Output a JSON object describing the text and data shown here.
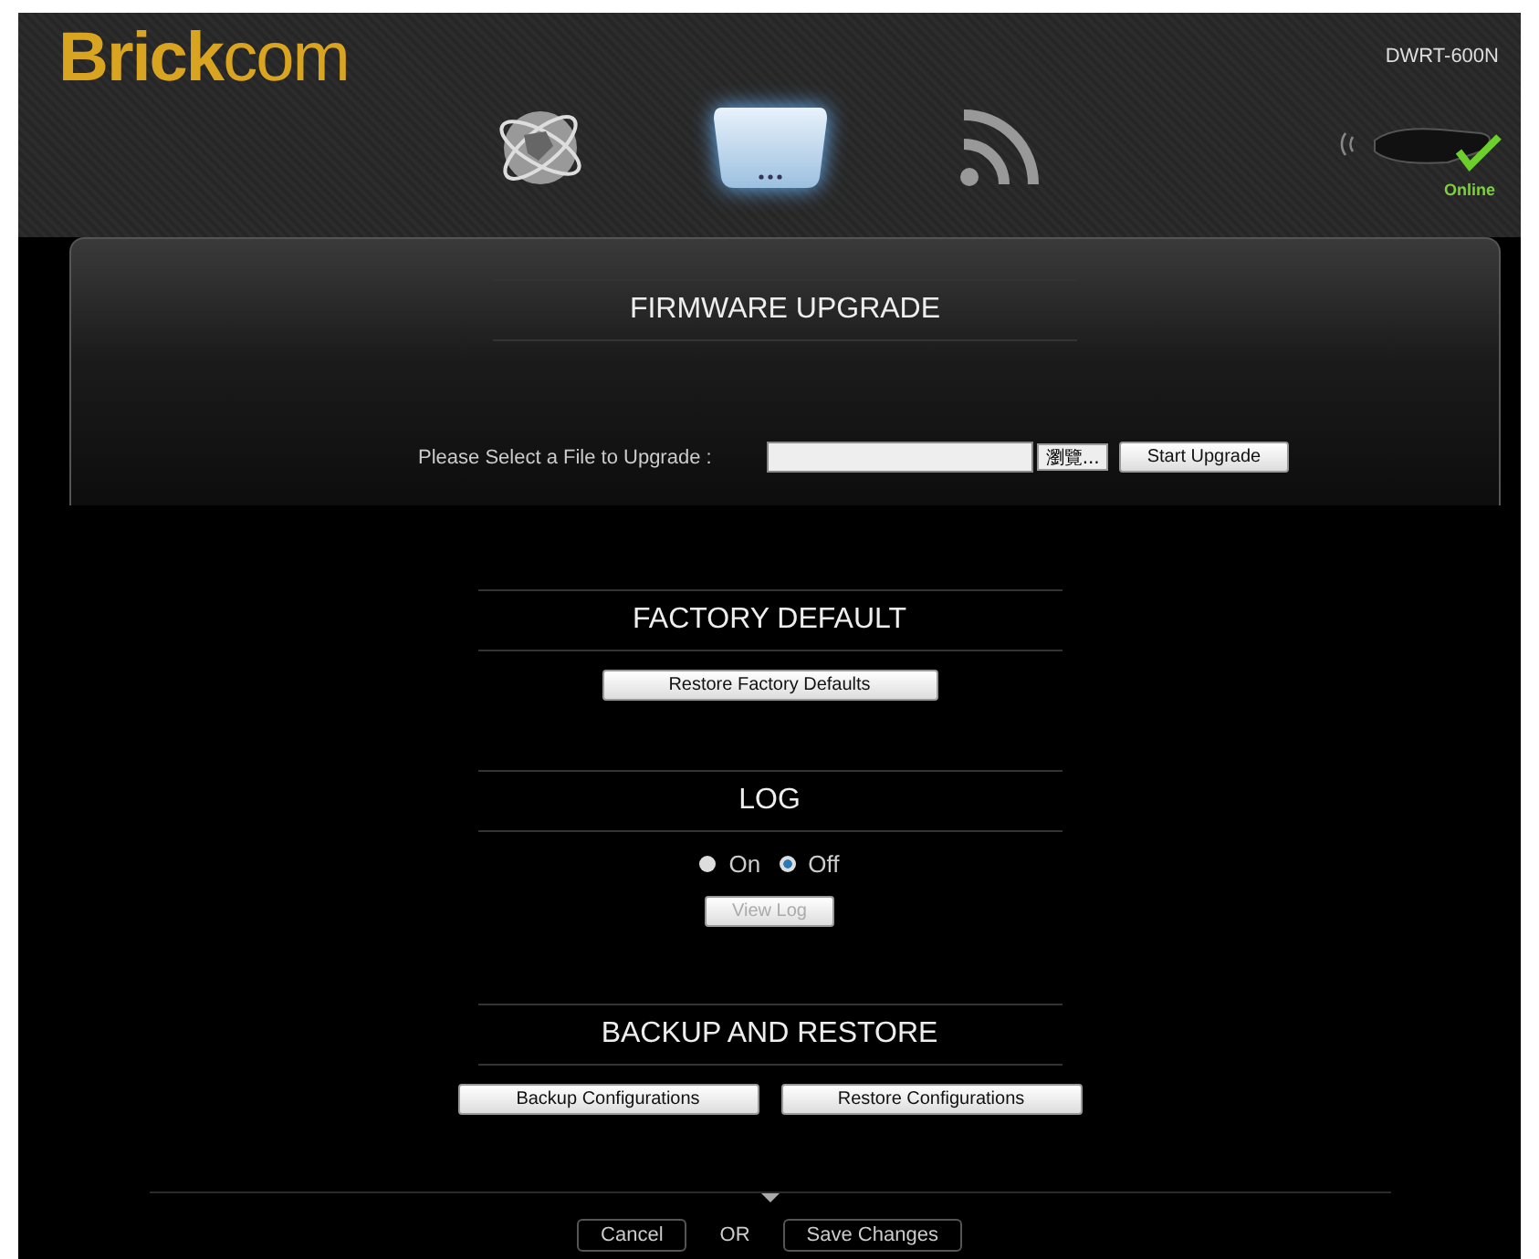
{
  "header": {
    "logo_bold": "Brick",
    "logo_light": "com",
    "model": "DWRT-600N",
    "status": "Online"
  },
  "nav": [
    {
      "kind": "globe",
      "selected": false
    },
    {
      "kind": "router",
      "selected": true
    },
    {
      "kind": "wireless",
      "selected": false
    }
  ],
  "sections": [
    {
      "kind": "upload",
      "title": "FIRMWARE UPGRADE",
      "label": "Please Select a File to Upgrade :",
      "browse": "瀏覽...",
      "button": "Start Upgrade"
    },
    {
      "kind": "buttons",
      "title": "FACTORY DEFAULT",
      "buttons": [
        {
          "label": "Restore Factory Defaults",
          "disabled": false
        }
      ]
    },
    {
      "kind": "radios",
      "title": "LOG",
      "options": [
        {
          "label": "On",
          "selected": false
        },
        {
          "label": "Off",
          "selected": true
        }
      ],
      "buttons": [
        {
          "label": "View Log",
          "disabled": true
        }
      ]
    },
    {
      "kind": "buttons",
      "title": "BACKUP AND RESTORE",
      "buttons": [
        {
          "label": "Backup Configurations",
          "disabled": false
        },
        {
          "label": "Restore Configurations",
          "disabled": false
        }
      ]
    }
  ],
  "footer": {
    "cancel": "Cancel",
    "separator": "OR",
    "save": "Save Changes"
  }
}
